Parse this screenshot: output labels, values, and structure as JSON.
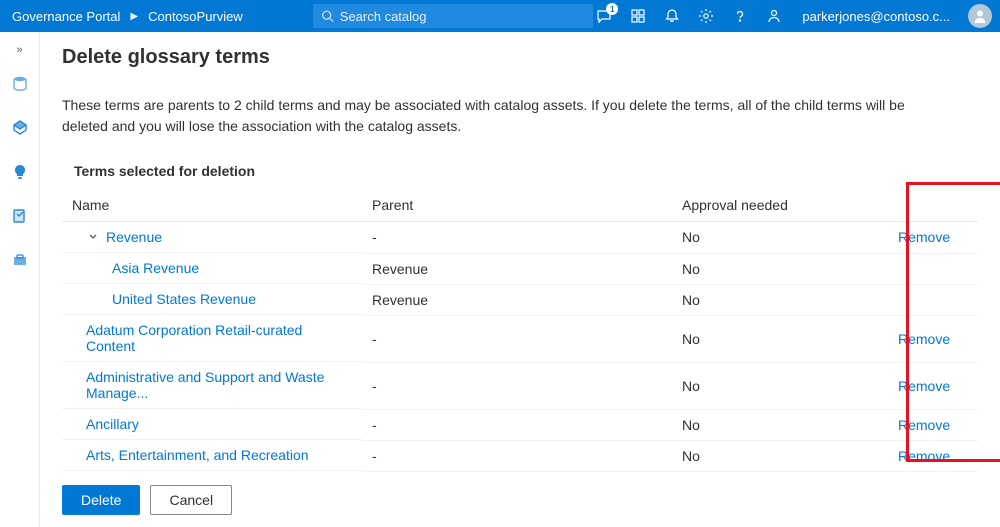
{
  "header": {
    "brand_left": "Governance Portal",
    "brand_right": "ContosoPurview",
    "notification_count": "1",
    "user_email": "parkerjones@contoso.c..."
  },
  "search": {
    "placeholder": "Search catalog"
  },
  "page": {
    "title": "Delete glossary terms",
    "description": "These terms are parents to 2 child terms and may be associated with catalog assets. If you delete the terms, all of the child terms will be deleted and you will lose the association with the catalog assets.",
    "section_label": "Terms selected for deletion"
  },
  "table": {
    "columns": {
      "name": "Name",
      "parent": "Parent",
      "approval": "Approval needed",
      "action": ""
    },
    "rows": [
      {
        "name": "Revenue",
        "parent": "-",
        "approval": "No",
        "remove": "Remove",
        "indent": 1,
        "expandable": true
      },
      {
        "name": "Asia Revenue",
        "parent": "Revenue",
        "approval": "No",
        "remove": "",
        "indent": 2,
        "expandable": false
      },
      {
        "name": "United States Revenue",
        "parent": "Revenue",
        "approval": "No",
        "remove": "",
        "indent": 2,
        "expandable": false
      },
      {
        "name": "Adatum Corporation Retail-curated Content",
        "parent": "-",
        "approval": "No",
        "remove": "Remove",
        "indent": 1,
        "expandable": false
      },
      {
        "name": "Administrative and Support and Waste Manage...",
        "parent": "-",
        "approval": "No",
        "remove": "Remove",
        "indent": 1,
        "expandable": false
      },
      {
        "name": "Ancillary",
        "parent": "-",
        "approval": "No",
        "remove": "Remove",
        "indent": 1,
        "expandable": false
      },
      {
        "name": "Arts, Entertainment, and Recreation",
        "parent": "-",
        "approval": "No",
        "remove": "Remove",
        "indent": 1,
        "expandable": false
      }
    ]
  },
  "footer": {
    "delete": "Delete",
    "cancel": "Cancel"
  },
  "icons": {
    "chat": "chat-icon",
    "copilot": "copilot-icon",
    "bell": "bell-icon",
    "settings": "gear-icon",
    "help": "help-icon",
    "feedback": "feedback-icon"
  },
  "colors": {
    "accent": "#0078d4",
    "link": "#0078d4",
    "highlight": "#e81123"
  }
}
